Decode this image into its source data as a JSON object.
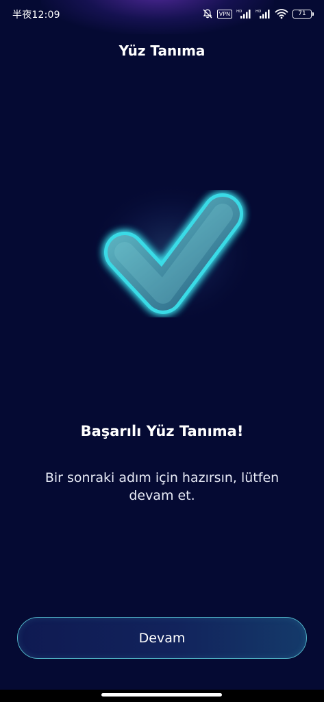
{
  "status_bar": {
    "time": "半夜12:09",
    "vpn_label": "VPN",
    "battery_level": "71",
    "icons": [
      "bell-off-icon",
      "vpn-icon",
      "signal-hd-icon",
      "signal-hd-icon",
      "wifi-icon",
      "battery-icon"
    ]
  },
  "header": {
    "title": "Yüz Tanıma"
  },
  "result": {
    "icon": "check-icon",
    "title": "Başarılı Yüz Tanıma!",
    "description": "Bir sonraki adım için hazırsın, lütfen devam et."
  },
  "actions": {
    "continue_label": "Devam"
  },
  "colors": {
    "background": "#050a33",
    "accent": "#4ee6f0",
    "text": "#ffffff"
  }
}
